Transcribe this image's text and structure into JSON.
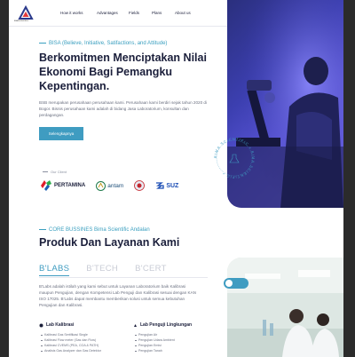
{
  "brand": {
    "logo_sub": "BIMA SCIENTIFIC"
  },
  "nav": {
    "links": [
      "How it works",
      "Advantages",
      "Fields",
      "Plans",
      "About us"
    ]
  },
  "hero": {
    "tagline": "BISA (Believe, Initiative, Satifactions, and Attitude)",
    "title": "Berkomitmen Menciptakan Nilai Ekonomi Bagi Pemangku Kepentingan.",
    "description": "BSB merupakan perusahaan perusahaan kami. Perusahaan kami berdiri sejak tahun 2020 di Bogor. Bisnis perusahaan kami adalah di bidang Jasa Laboratorium, konsultan dan perdagangan.",
    "cta_label": "Selengkapnya",
    "badge_text": "BIMA SCIENTIFIC • BIMA SCIENTIFIC •",
    "clients_label": "Our Client",
    "clients": [
      "PERTAMINA",
      "antam",
      "SUZ"
    ]
  },
  "services": {
    "tagline": "CORE BUSSINES Bima Scientific Andalan",
    "title": "Produk Dan Layanan Kami",
    "tabs": [
      "B'LABS",
      "B'TECH",
      "B'CERT"
    ],
    "active_tab": "B'LABS",
    "description": "B'Labs adalah istilah yang kami sebut untuk Layanan Laboratorium baik Kalibrasi maupun Pengujian, dengan Kompetensi Lab Penguji dan Kalibrasi sesuai dengan KAN ISO 17025. B'Labs dapat membantu memberikan solusi untuk semua kebutuhan Pengujian dan Kalibrasi.",
    "kalibrasi": {
      "title": "Lab Kalibrasi",
      "items": [
        "Kalibrasi Gas Sertifikasi Single",
        "Kalibrasi Flow meter (Gas dan Flow)",
        "Kalibrasi CVEMS (PEA, COA & PATH)",
        "Analisis Gas Analyzer dan Gas Detektor"
      ]
    },
    "lingkungan": {
      "title": "Lab Penguji Lingkungan",
      "items": [
        "Pengujian Air",
        "Pengujian Udara Ambient",
        "Pengujian Emisi",
        "Pengujian Tanah"
      ]
    }
  },
  "colors": {
    "accent": "#3f9cc1",
    "dark": "#1b1f3b",
    "hero_purple": "#4b4bc6"
  }
}
